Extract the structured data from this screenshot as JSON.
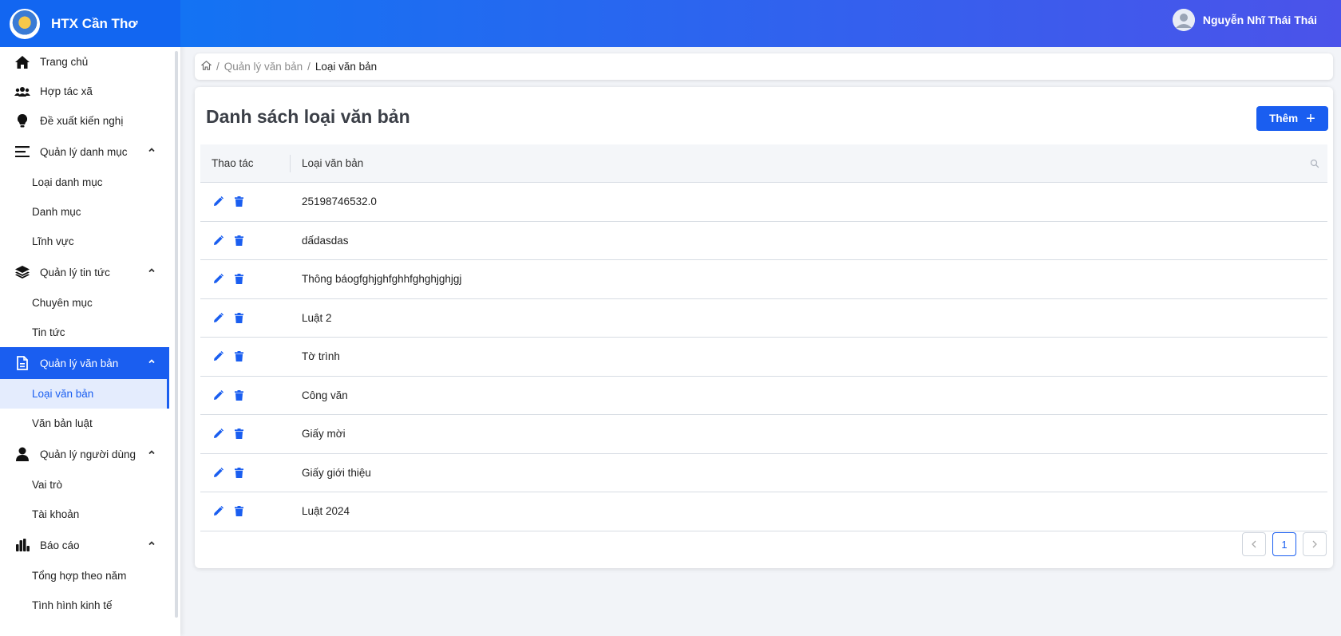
{
  "brand": {
    "name": "HTX Cần Thơ"
  },
  "user": {
    "name": "Nguyễn Nhĩ Thái Thái"
  },
  "colors": {
    "primary": "#1a5ef0",
    "header_start": "#1373f3",
    "header_end": "#4b53ea"
  },
  "sidebar": {
    "home": "Trang chủ",
    "coop": "Hợp tác xã",
    "proposal": "Đề xuất kiến nghị",
    "category_group": "Quản lý danh mục",
    "category_sub": [
      "Loại danh mục",
      "Danh mục",
      "Lĩnh vực"
    ],
    "news_group": "Quản lý tin tức",
    "news_sub": [
      "Chuyên mục",
      "Tin tức"
    ],
    "docs_group": "Quản lý văn bản",
    "docs_sub": [
      "Loại văn bản",
      "Văn bản luật"
    ],
    "users_group": "Quản lý người dùng",
    "users_sub": [
      "Vai trò",
      "Tài khoản"
    ],
    "report_group": "Báo cáo",
    "report_sub": [
      "Tổng hợp theo năm",
      "Tình hình kinh tế"
    ]
  },
  "breadcrumb": {
    "parent": "Quản lý văn bản",
    "current": "Loại văn bản"
  },
  "page": {
    "title": "Danh sách loại văn bản",
    "add_label": "Thêm"
  },
  "table": {
    "col_actions": "Thao tác",
    "col_type": "Loại văn bản",
    "rows": [
      "25198746532.0",
      "dấdasdas",
      "Thông báogfghjghfghhfghghjghjgj",
      "Luật 2",
      "Tờ trình",
      "Công văn",
      "Giấy mời",
      "Giấy giới thiệu",
      "Luật 2024"
    ]
  },
  "pagination": {
    "current_page": "1"
  }
}
